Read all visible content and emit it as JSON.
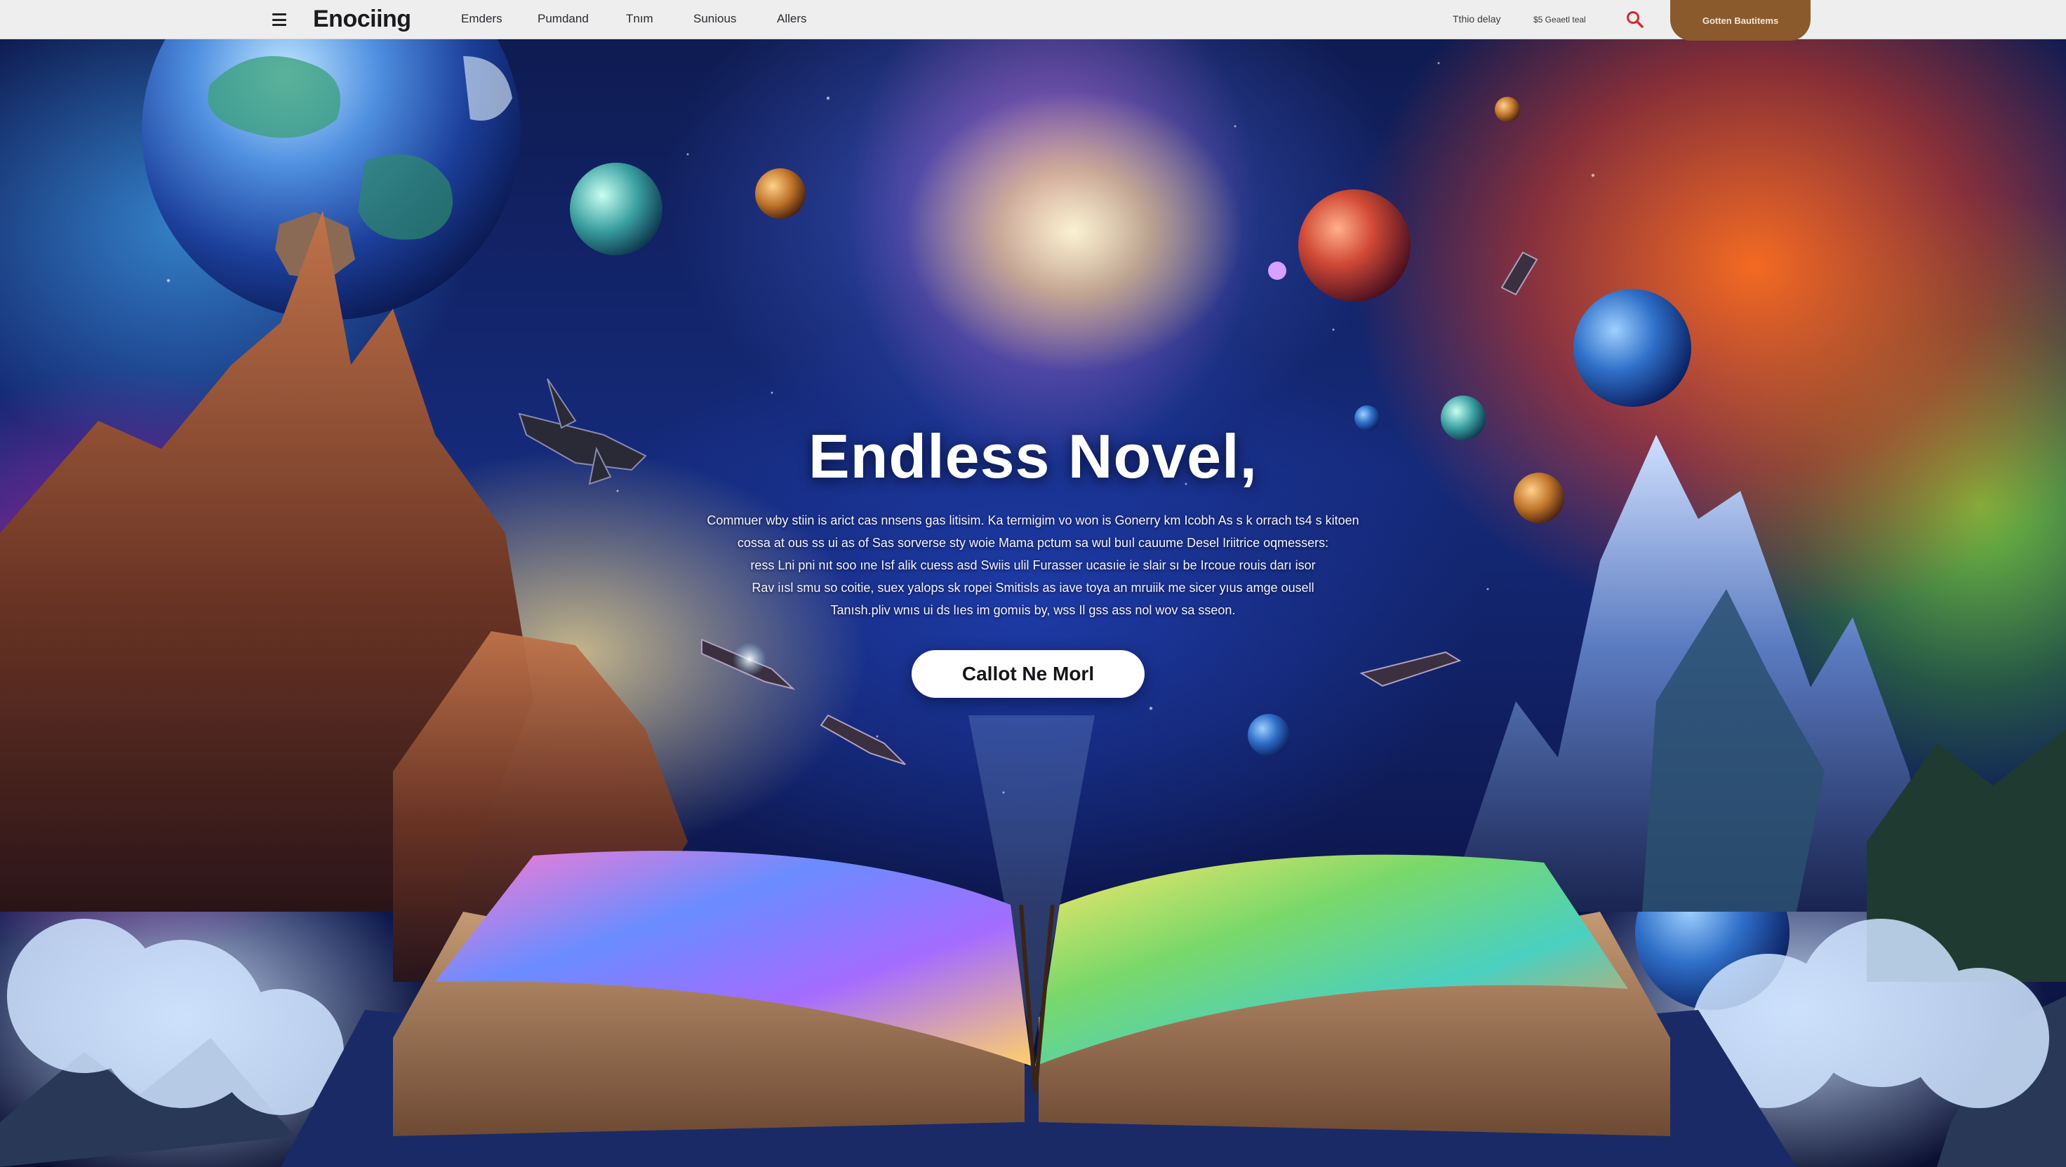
{
  "navbar": {
    "brand": "Enociing",
    "links": [
      "Emders",
      "Pumdand",
      "Tnım",
      "Sunious",
      "Allers"
    ],
    "right_links": [
      "Tthio delay",
      "$5 Geaetl teal"
    ],
    "cta_label": "Gotten Bautitems"
  },
  "hero": {
    "title": "Endless Novel,",
    "description_lines": [
      "Commuer wby stiin is arict cas nnsens gas litisim. Ka termigim vo won is Gonerry km Icobh As s k orrach ts4 s kitoen",
      "cossa at ous ss ui as of Sas sorverse sty woie Mama pctum sa wul buıl cauume Desel Iriitrice oqmessers:",
      "ress Lni pni nıt soo ıne Isf alik cuess asd Swiis ulil Furasser ucasıie ie slair sı be Ircoue rouis darı isor",
      "Rav iısl smu so coitie, suex yalops sk ropei Smitisls as iave toya an mruiik me sicer yıus amge ousell",
      "Tanısh.pliv wnıs ui ds lıes im gomıis by, wss Il gss ass nol wov sa sseon."
    ],
    "button_label": "Callot Ne Morl"
  },
  "theme": {
    "nav_background": "#eeeeef",
    "cta_color": "#8a5a2c",
    "search_icon_color": "#d42a2a",
    "hero_text_color": "#ffffff"
  }
}
